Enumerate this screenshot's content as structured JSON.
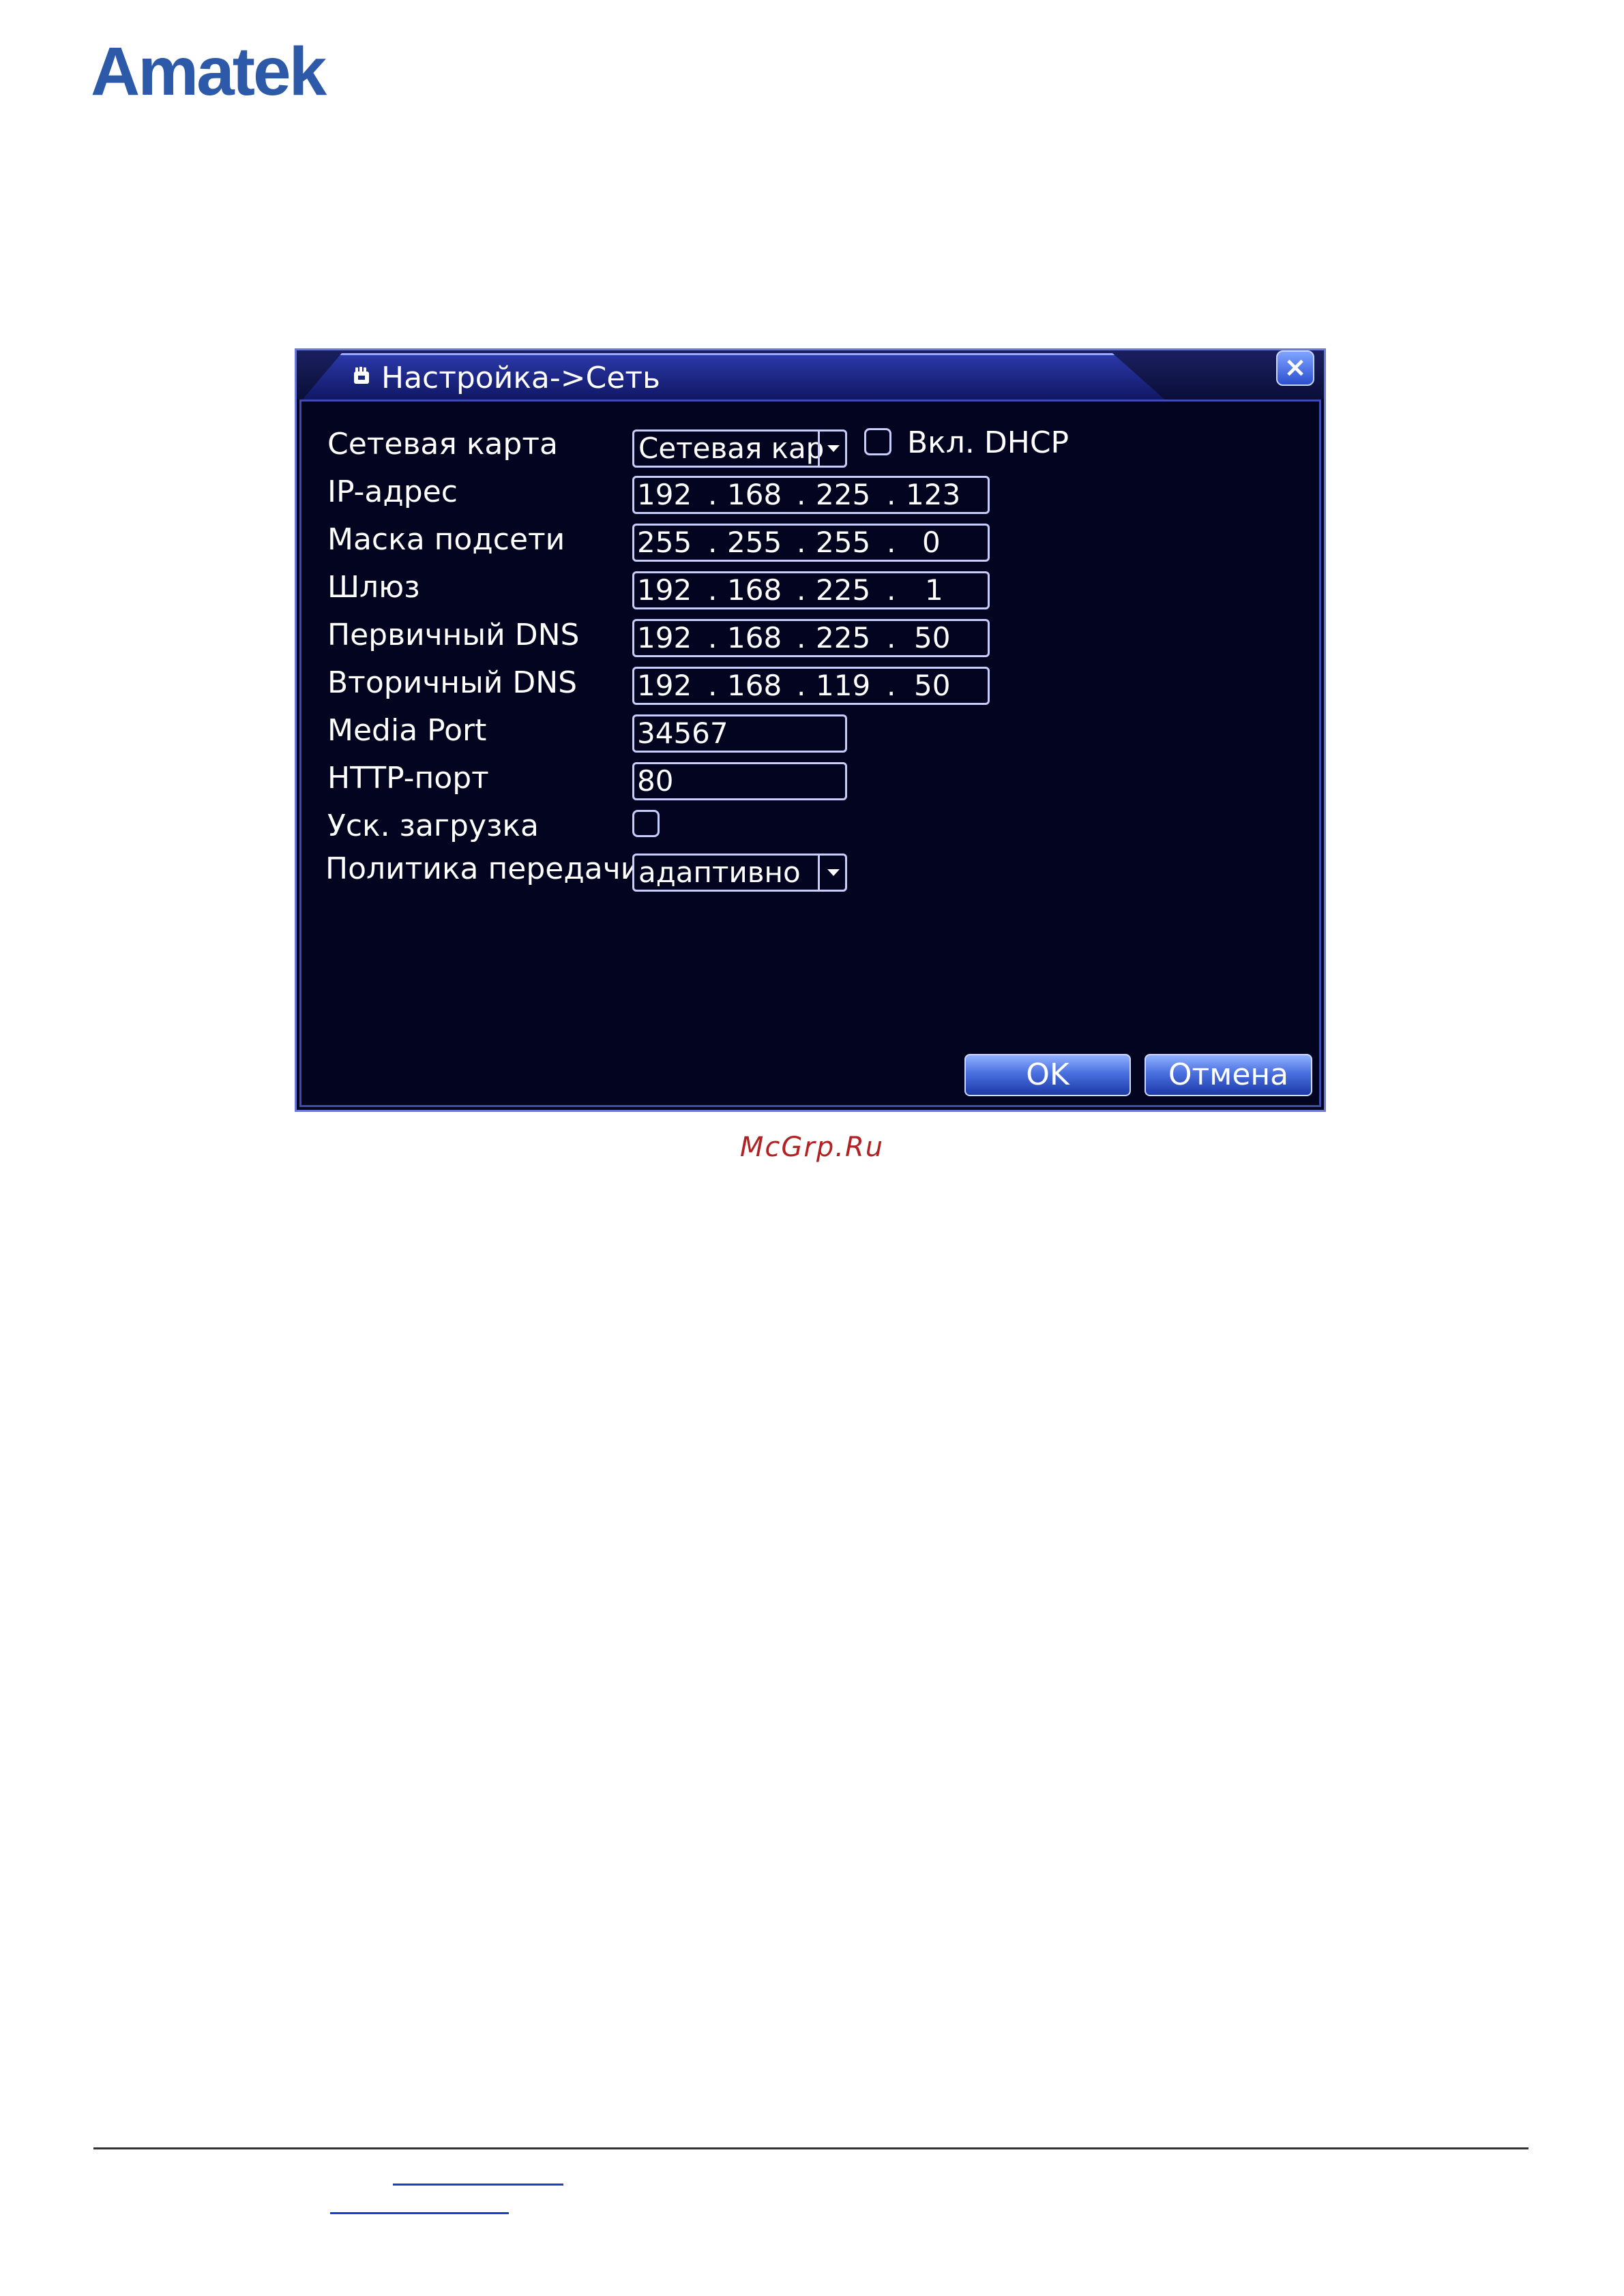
{
  "brand": {
    "logo": "Amatek"
  },
  "dialog": {
    "title": "Настройка->Сеть",
    "close": "×",
    "rows": [
      {
        "label": "Сетевая карта"
      },
      {
        "label": "IP-адрес"
      },
      {
        "label": "Маска подсети"
      },
      {
        "label": "Шлюз"
      },
      {
        "label": "Первичный DNS"
      },
      {
        "label": "Вторичный DNS"
      },
      {
        "label": "Media Port"
      },
      {
        "label": "HTTP-порт"
      },
      {
        "label": "Уск. загрузка"
      },
      {
        "label": "Политика передачи"
      }
    ],
    "nic_value": "Сетевая кар",
    "dhcp_label": "Вкл. DHCP",
    "dhcp_checked": false,
    "ip": [
      "192",
      "168",
      "225",
      "123"
    ],
    "mask": [
      "255",
      "255",
      "255",
      "0"
    ],
    "gateway": [
      "192",
      "168",
      "225",
      "1"
    ],
    "dns1": [
      "192",
      "168",
      "225",
      "50"
    ],
    "dns2": [
      "192",
      "168",
      "119",
      "50"
    ],
    "media_port": "34567",
    "http_port": "80",
    "fast_boot_checked": false,
    "policy_value": "адаптивно",
    "ok_label": "OK",
    "cancel_label": "Отмена"
  },
  "caption": "McGrp.Ru"
}
